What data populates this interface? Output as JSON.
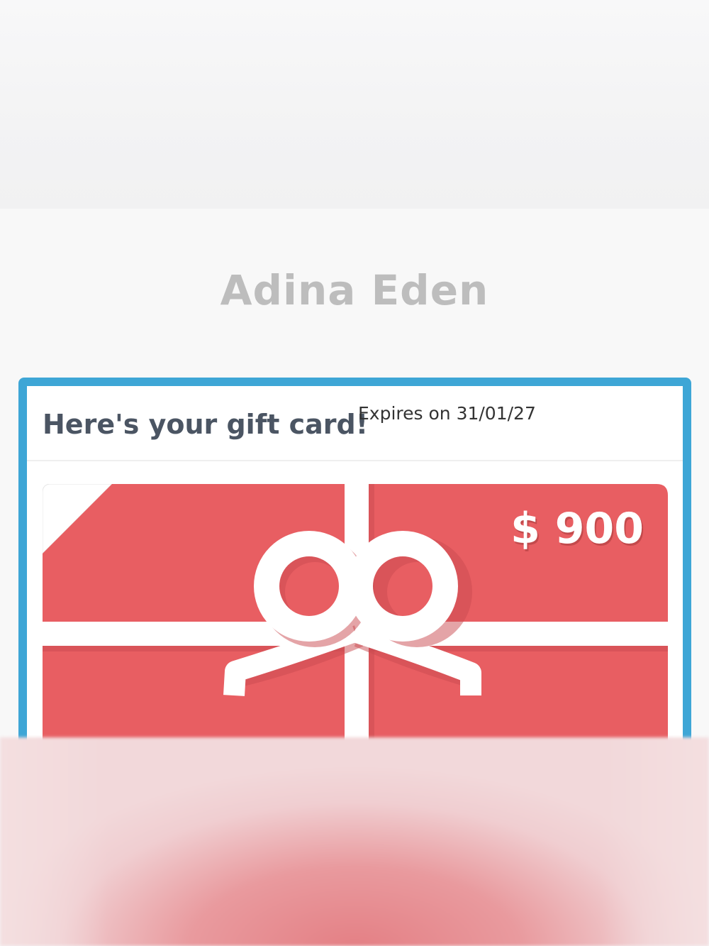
{
  "recipient": {
    "name": "Adina Eden"
  },
  "gift_card": {
    "header_title": "Here's your gift card!",
    "expires_text": "Expires on 31/01/27",
    "amount": "$ 900",
    "card_color": "#e85e62",
    "ribbon_color": "#ffffff",
    "frame_color": "#3ea6d6"
  },
  "icons": {
    "gift_ribbon": "gift-bow-icon"
  }
}
